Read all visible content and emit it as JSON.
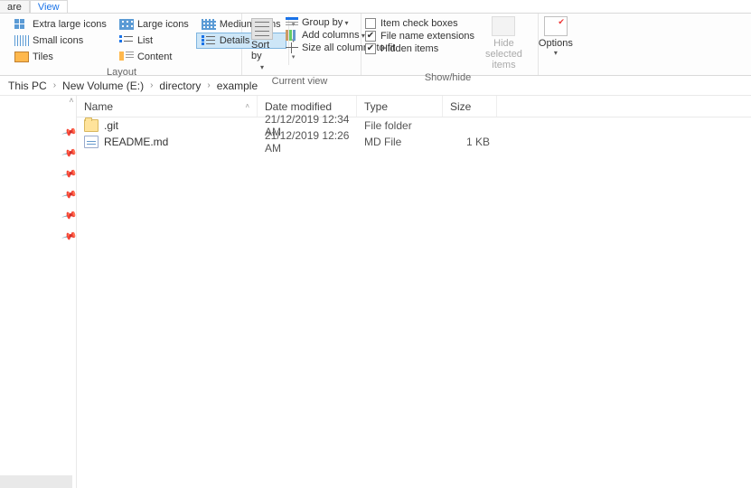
{
  "tabs": {
    "share": "are",
    "view": "View"
  },
  "ribbon": {
    "layout": {
      "label": "Layout",
      "extra_large": "Extra large icons",
      "large": "Large icons",
      "medium": "Medium icons",
      "small": "Small icons",
      "list": "List",
      "details": "Details",
      "tiles": "Tiles",
      "content": "Content"
    },
    "current_view": {
      "label": "Current view",
      "sort_by": "Sort by",
      "group_by": "Group by",
      "add_columns": "Add columns",
      "size_fit": "Size all columns to fit"
    },
    "show_hide": {
      "label": "Show/hide",
      "item_check": "Item check boxes",
      "file_ext": "File name extensions",
      "hidden": "Hidden items",
      "hide_selected": "Hide selected items",
      "options": "Options"
    }
  },
  "breadcrumb": {
    "seg0": "This PC",
    "seg1": "New Volume (E:)",
    "seg2": "directory",
    "seg3": "example"
  },
  "columns": {
    "name": "Name",
    "date": "Date modified",
    "type": "Type",
    "size": "Size"
  },
  "files": [
    {
      "icon": "folder",
      "name": ".git",
      "date": "21/12/2019 12:34 AM",
      "type": "File folder",
      "size": ""
    },
    {
      "icon": "md",
      "name": "README.md",
      "date": "21/12/2019 12:26 AM",
      "type": "MD File",
      "size": "1 KB"
    }
  ]
}
